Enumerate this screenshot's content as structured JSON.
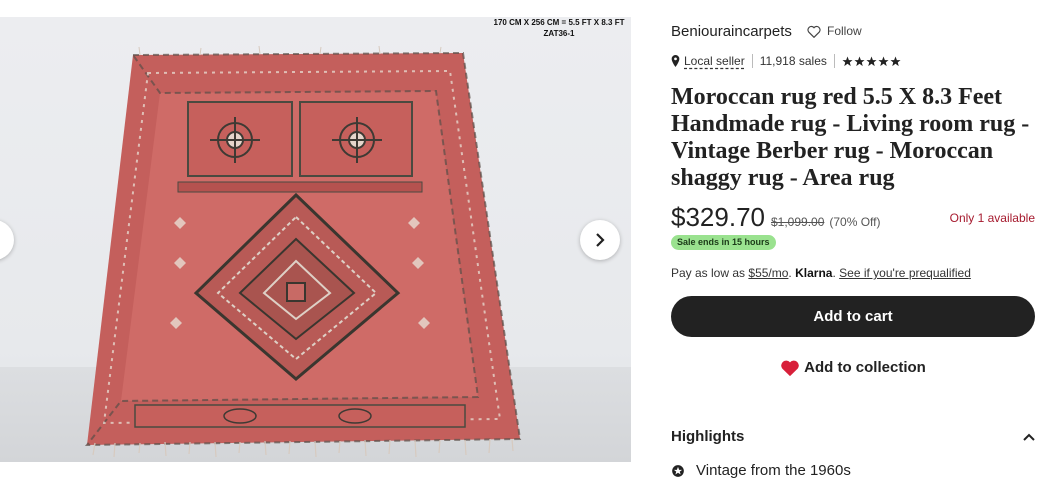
{
  "image": {
    "caption_line1": "170 CM X 256 CM = 5.5 FT X 8.3 FT",
    "caption_line2": "ZAT36-1",
    "prev_icon": "chevron-left-icon",
    "next_icon": "chevron-right-icon",
    "rug_colors": {
      "field": "#cf6a66",
      "border": "#c2605c",
      "pattern_dark": "#4a4a40",
      "pattern_light": "#e8d9cf"
    }
  },
  "shop": {
    "name": "Beniouraincarpets",
    "follow_label": "Follow",
    "follow_icon": "heart-outline-icon"
  },
  "meta": {
    "pin_icon": "map-pin-icon",
    "local_seller": "Local seller",
    "sales": "11,918 sales",
    "rating_stars": 5
  },
  "product": {
    "title": "Moroccan rug red 5.5 X 8.3 Feet Handmade rug - Living room rug - Vintage Berber rug - Moroccan shaggy rug - Area rug",
    "price": "$329.70",
    "old_price": "$1,099.00",
    "discount": "(70% Off)",
    "availability": "Only 1 available",
    "sale_badge": "Sale ends in 15 hours"
  },
  "payment": {
    "prefix": "Pay as low as",
    "monthly": "$55/mo",
    "dot": ".",
    "provider": "Klarna",
    "prequal_link": "See if you're prequalified"
  },
  "actions": {
    "add_to_cart": "Add to cart",
    "add_to_collection": "Add to collection",
    "collection_icon": "heart-filled-icon"
  },
  "highlights": {
    "heading": "Highlights",
    "chevron_icon": "chevron-up-icon",
    "items": [
      {
        "icon": "star-badge-icon",
        "text": "Vintage from the 1960s"
      }
    ]
  },
  "colors": {
    "accent_red": "#d8203a",
    "available_red": "#a61a2e",
    "badge_green": "#9ae28f",
    "button_dark": "#222222"
  }
}
